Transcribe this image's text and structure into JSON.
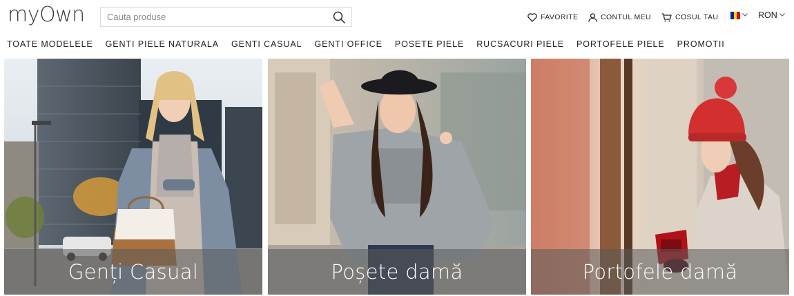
{
  "header": {
    "logo": "myOwn",
    "search": {
      "placeholder": "Cauta produse",
      "value": ""
    },
    "links": {
      "favorites": "FAVORITE",
      "account": "CONTUL MEU",
      "cart": "COSUL TAU"
    },
    "currency": "RON"
  },
  "nav": [
    "TOATE MODELELE",
    "GENTI PIELE NATURALA",
    "GENTI CASUAL",
    "GENTI OFFICE",
    "POSETE PIELE",
    "RUCSACURI PIELE",
    "PORTOFELE PIELE",
    "PROMOTII"
  ],
  "banners": [
    {
      "caption": "Genți Casual",
      "image": "woman in grey coat with white-and-tan handbag on city street"
    },
    {
      "caption": "Poșete damă",
      "image": "woman in black hat and grey knit poncho"
    },
    {
      "caption": "Portofele damă",
      "image": "woman in red beanie holding red wallet"
    }
  ],
  "icons": {
    "search": "search-icon",
    "favorites": "heart-icon",
    "account": "user-icon",
    "cart": "cart-icon",
    "language": "romania-flag-icon"
  },
  "colors": {
    "flag_blue": "#002b7f",
    "flag_yellow": "#fcd116",
    "flag_red": "#ce1126",
    "caption_overlay": "#5a5a5a"
  }
}
